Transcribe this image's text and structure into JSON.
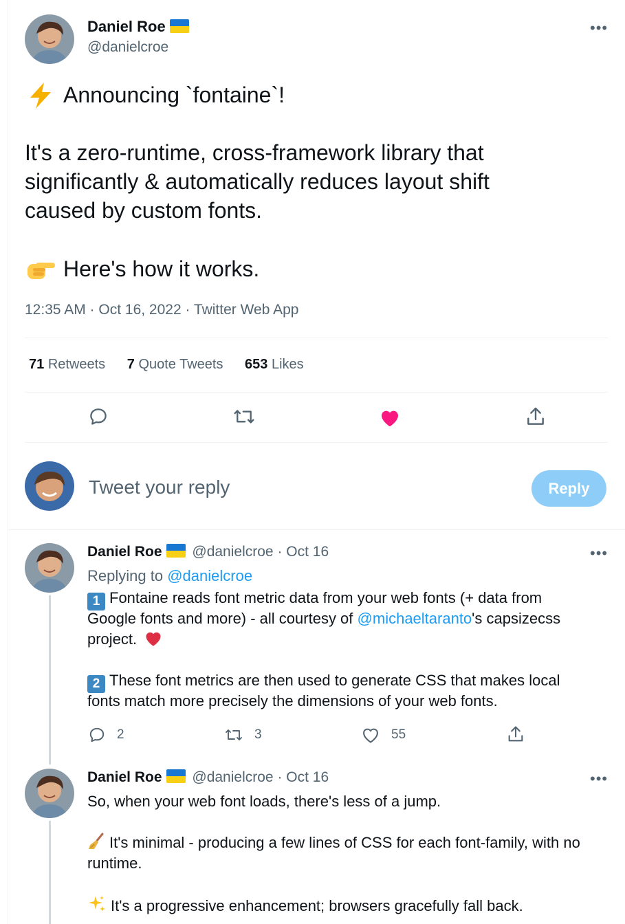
{
  "tweet": {
    "author": {
      "name": "Daniel Roe",
      "handle": "@danielcroe"
    },
    "more": "•••",
    "line1": "Announcing `fontaine`!",
    "line2": "It's a zero-runtime, cross-framework library that",
    "line3": "significantly & automatically reduces layout shift",
    "line4": "caused by custom fonts.",
    "line5": "Here's how it works.",
    "meta": "12:35 AM · Oct 16, 2022 · Twitter Web App",
    "stats": {
      "retweets_count": "71",
      "retweets_label": "Retweets",
      "quotes_count": "7",
      "quotes_label": "Quote Tweets",
      "likes_count": "653",
      "likes_label": "Likes"
    }
  },
  "composer": {
    "placeholder": "Tweet your reply",
    "reply_label": "Reply"
  },
  "replies": [
    {
      "name": "Daniel Roe",
      "handle": "@danielcroe",
      "dot": "·",
      "date": "Oct 16",
      "replying_prefix": "Replying to",
      "replying_handle": "@danielcroe",
      "num1": "1",
      "p1a": "Fontaine reads font metric data from your web fonts (+ data from",
      "p1b_pre": "Google fonts and more) - all courtesy of ",
      "p1b_link": "@michaeltaranto",
      "p1b_post": "'s capsizecss",
      "p1c": "project.",
      "num2": "2",
      "p2a": "These font metrics are then used to generate CSS that makes local",
      "p2b": "fonts match more precisely the dimensions of your web fonts.",
      "reply_count": "2",
      "retweet_count": "3",
      "like_count": "55"
    },
    {
      "name": "Daniel Roe",
      "handle": "@danielcroe",
      "dot": "·",
      "date": "Oct 16",
      "p1": "So, when your web font loads, there's less of a jump.",
      "p2a": "It's minimal - producing a few lines of CSS for each font-family, with no",
      "p2b": "runtime.",
      "p3": "It's a progressive enhancement; browsers gracefully fall back."
    }
  ],
  "colors": {
    "accent": "#1d9bf0",
    "like": "#f91880",
    "muted": "#536471"
  },
  "icons": [
    "lightning-emoji",
    "pointing-hand-emoji",
    "reply-icon",
    "retweet-icon",
    "heart-icon",
    "share-icon",
    "red-heart-emoji",
    "broom-emoji",
    "sparkles-emoji"
  ]
}
